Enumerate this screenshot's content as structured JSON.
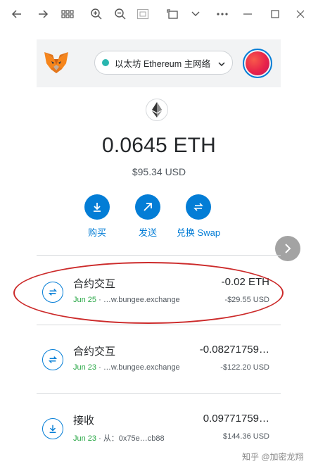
{
  "network": {
    "label": "以太坊 Ethereum 主网络",
    "status_color": "#29b6af"
  },
  "balance": {
    "amount": "0.0645 ETH",
    "fiat": "$95.34 USD"
  },
  "actions": [
    {
      "label": "购买",
      "icon": "download-icon"
    },
    {
      "label": "发送",
      "icon": "arrow-up-right-icon"
    },
    {
      "label": "兑换 Swap",
      "icon": "swap-icon"
    }
  ],
  "transactions": [
    {
      "title": "合约交互",
      "date": "Jun 25",
      "sep": " · ",
      "detail": "…w.bungee.exchange",
      "amount": "-0.02 ETH",
      "fiat": "-$29.55 USD",
      "icon": "swap-icon"
    },
    {
      "title": "合约交互",
      "date": "Jun 23",
      "sep": " · ",
      "detail": "…w.bungee.exchange",
      "amount": "-0.08271759…",
      "fiat": "-$122.20 USD",
      "icon": "swap-icon"
    },
    {
      "title": "接收",
      "date": "Jun 23",
      "sep": " · ",
      "detail": "从：0x75e…cb88",
      "amount": "0.09771759…",
      "fiat": "$144.36 USD",
      "icon": "receive-icon"
    }
  ],
  "watermark": "知乎 @加密龙翔",
  "colors": {
    "accent": "#037dd6",
    "date_green": "#28a745",
    "highlight_red": "#cc2a2a"
  }
}
